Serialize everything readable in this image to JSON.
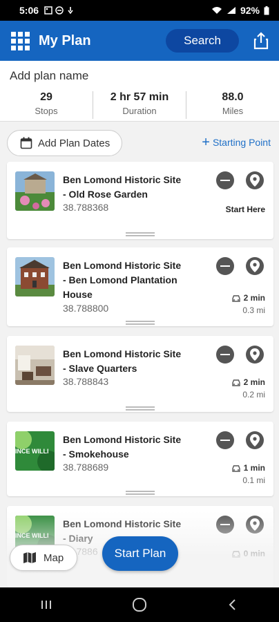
{
  "status": {
    "time": "5:06",
    "battery": "92%"
  },
  "header": {
    "title": "My Plan",
    "search_label": "Search"
  },
  "plan": {
    "name_placeholder": "Add plan name",
    "stats": [
      {
        "value": "29",
        "label": "Stops"
      },
      {
        "value": "2 hr 57 min",
        "label": "Duration"
      },
      {
        "value": "88.0",
        "label": "Miles"
      }
    ]
  },
  "actions": {
    "dates_label": "Add Plan Dates",
    "starting_point_label": "Starting Point"
  },
  "stops": [
    {
      "line1": "Ben Lomond Historic Site",
      "line2": "- Old Rose Garden",
      "line3": "",
      "coord": "38.788368",
      "start_here": "Start Here"
    },
    {
      "line1": "Ben Lomond Historic Site",
      "line2": "- Ben Lomond Plantation",
      "line3": "House",
      "coord": "38.788800",
      "drive_time": "2 min",
      "distance": "0.3 mi"
    },
    {
      "line1": "Ben Lomond Historic Site",
      "line2": "- Slave Quarters",
      "line3": "",
      "coord": "38.788843",
      "drive_time": "2 min",
      "distance": "0.2 mi"
    },
    {
      "line1": "Ben Lomond Historic Site",
      "line2": "- Smokehouse",
      "line3": "",
      "coord": "38.788689",
      "drive_time": "1 min",
      "distance": "0.1 mi"
    },
    {
      "line1": "Ben Lomond Historic Site",
      "line2": "- Diary",
      "line3": "",
      "coord": "38.7886",
      "drive_time": "0 min",
      "distance": ""
    }
  ],
  "thumb_text": "INCE WILLI",
  "bottom": {
    "map_label": "Map",
    "start_plan_label": "Start Plan"
  },
  "colors": {
    "brand_blue": "#1565c0",
    "accent_link": "#1e6fc7"
  }
}
